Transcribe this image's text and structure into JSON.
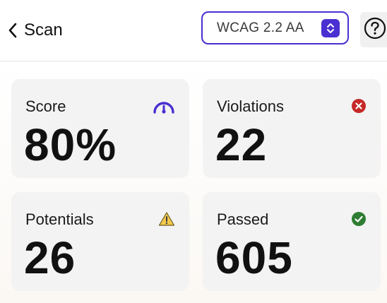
{
  "header": {
    "title": "Scan",
    "standard": "WCAG 2.2 AA"
  },
  "cards": [
    {
      "label": "Score",
      "value": "80%",
      "icon": "gauge-icon"
    },
    {
      "label": "Violations",
      "value": "22",
      "icon": "error-icon"
    },
    {
      "label": "Potentials",
      "value": "26",
      "icon": "warning-icon"
    },
    {
      "label": "Passed",
      "value": "605",
      "icon": "check-icon"
    }
  ],
  "colors": {
    "accent": "#4a2fd1",
    "error": "#c62828",
    "warning": "#f2c94c",
    "success": "#2e7d32"
  }
}
